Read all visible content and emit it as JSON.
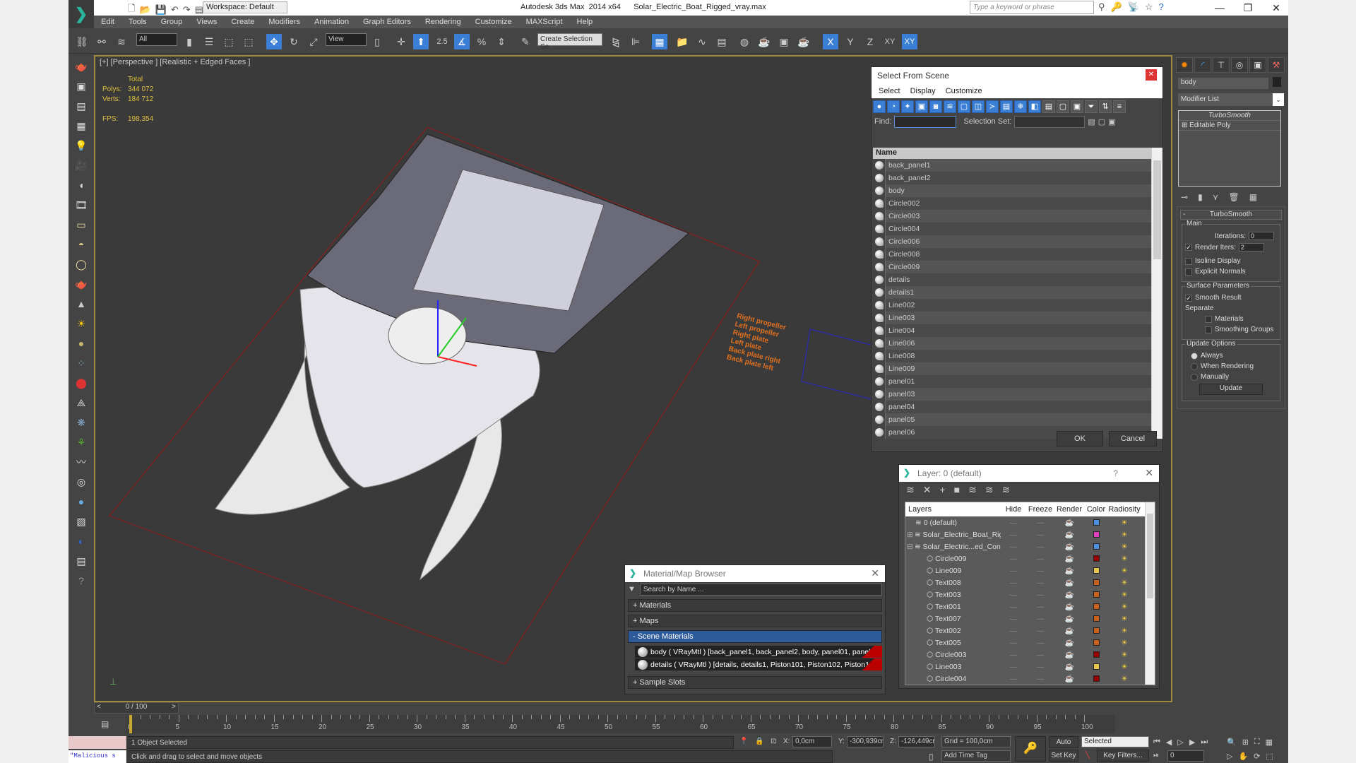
{
  "titlebar": {
    "workspace": "Workspace: Default",
    "app_title": "Autodesk 3ds Max  2014 x64",
    "file_name": "Solar_Electric_Boat_Rigged_vray.max",
    "search_placeholder": "Type a keyword or phrase"
  },
  "menu": [
    "Edit",
    "Tools",
    "Group",
    "Views",
    "Create",
    "Modifiers",
    "Animation",
    "Graph Editors",
    "Rendering",
    "Customize",
    "MAXScript",
    "Help"
  ],
  "toolbar": {
    "selection_filter": "All",
    "ref_coord": "View",
    "snap_angle": "2.5",
    "named_selection_placeholder": "Create Selection Se",
    "axes": [
      "X",
      "Y",
      "Z",
      "XY",
      "XY"
    ]
  },
  "viewport": {
    "label": "[+] [Perspective ] [Realistic + Edged Faces ]",
    "stats_header": "Total",
    "polys_label": "Polys:",
    "polys": "344 072",
    "verts_label": "Verts:",
    "verts": "184 712",
    "fps_label": "FPS:",
    "fps": "198,354",
    "control_labels": [
      "Right propeller",
      "Left propeller",
      "Right plate",
      "Left plate",
      "Back plate right",
      "Back plate left"
    ]
  },
  "select_from_scene": {
    "title": "Select From Scene",
    "menu": [
      "Select",
      "Display",
      "Customize"
    ],
    "find_label": "Find:",
    "selection_set_label": "Selection Set:",
    "column_name": "Name",
    "items": [
      {
        "name": "back_panel1",
        "type": "geometry"
      },
      {
        "name": "back_panel2",
        "type": "geometry"
      },
      {
        "name": "body",
        "type": "geometry"
      },
      {
        "name": "Circle002",
        "type": "shape"
      },
      {
        "name": "Circle003",
        "type": "shape"
      },
      {
        "name": "Circle004",
        "type": "shape"
      },
      {
        "name": "Circle006",
        "type": "shape"
      },
      {
        "name": "Circle008",
        "type": "shape"
      },
      {
        "name": "Circle009",
        "type": "shape"
      },
      {
        "name": "details",
        "type": "geometry"
      },
      {
        "name": "details1",
        "type": "geometry"
      },
      {
        "name": "Line002",
        "type": "shape"
      },
      {
        "name": "Line003",
        "type": "shape"
      },
      {
        "name": "Line004",
        "type": "shape"
      },
      {
        "name": "Line006",
        "type": "shape"
      },
      {
        "name": "Line008",
        "type": "shape"
      },
      {
        "name": "Line009",
        "type": "shape"
      },
      {
        "name": "panel01",
        "type": "geometry"
      },
      {
        "name": "panel03",
        "type": "geometry"
      },
      {
        "name": "panel04",
        "type": "geometry"
      },
      {
        "name": "panel05",
        "type": "geometry"
      },
      {
        "name": "panel06",
        "type": "geometry"
      }
    ],
    "ok": "OK",
    "cancel": "Cancel"
  },
  "layer_dialog": {
    "title": "Layer: 0 (default)",
    "help": "?",
    "columns": [
      "Layers",
      "Hide",
      "Freeze",
      "Render",
      "Color",
      "Radiosity"
    ],
    "rows": [
      {
        "name": "0 (default)",
        "indent": 1,
        "color": "#4a90e2"
      },
      {
        "name": "Solar_Electric_Boat_Rig",
        "indent": 0,
        "expander": "+",
        "color": "#e040c0"
      },
      {
        "name": "Solar_Electric...ed_Con",
        "indent": 0,
        "expander": "-",
        "color": "#4a90e2"
      },
      {
        "name": "Circle009",
        "indent": 2,
        "color": "#9b0000"
      },
      {
        "name": "Line009",
        "indent": 2,
        "color": "#e8c84a"
      },
      {
        "name": "Text008",
        "indent": 2,
        "color": "#c8601a"
      },
      {
        "name": "Text003",
        "indent": 2,
        "color": "#c8601a"
      },
      {
        "name": "Text001",
        "indent": 2,
        "color": "#c8601a"
      },
      {
        "name": "Text007",
        "indent": 2,
        "color": "#c8601a"
      },
      {
        "name": "Text002",
        "indent": 2,
        "color": "#c8601a"
      },
      {
        "name": "Text005",
        "indent": 2,
        "color": "#c8601a"
      },
      {
        "name": "Circle003",
        "indent": 2,
        "color": "#9b0000"
      },
      {
        "name": "Line003",
        "indent": 2,
        "color": "#e8c84a"
      },
      {
        "name": "Circle004",
        "indent": 2,
        "color": "#9b0000"
      }
    ]
  },
  "material_browser": {
    "title": "Material/Map Browser",
    "search_placeholder": "Search by Name ...",
    "sections": [
      "+ Materials",
      "+ Maps",
      "- Scene Materials",
      "+ Sample Slots"
    ],
    "scene_materials": [
      "body  ( VRayMtl ) [back_panel1, back_panel2, body, panel01, panel...",
      "details  ( VRayMtl ) [details, details1, Piston101, Piston102, Piston1..."
    ]
  },
  "command_panel": {
    "object_name": "body",
    "modifier_list": "Modifier List",
    "stack": [
      "TurboSmooth",
      "Editable Poly"
    ],
    "rollout_title": "TurboSmooth",
    "main_group": "Main",
    "iterations_label": "Iterations:",
    "iterations": "0",
    "render_iters_label": "Render Iters:",
    "render_iters": "2",
    "render_iters_checked": true,
    "isoline_display": "Isoline Display",
    "explicit_normals": "Explicit Normals",
    "surface_group": "Surface Parameters",
    "smooth_result": "Smooth Result",
    "separate": "Separate",
    "materials": "Materials",
    "smoothing_groups": "Smoothing Groups",
    "update_group": "Update Options",
    "update_options": [
      "Always",
      "When Rendering",
      "Manually"
    ],
    "update_selected": "Always",
    "update_button": "Update"
  },
  "timeline": {
    "frame_slider": "0 / 100",
    "ticks": [
      "0",
      "5",
      "10",
      "15",
      "20",
      "25",
      "30",
      "35",
      "40",
      "45",
      "50",
      "55",
      "60",
      "65",
      "70",
      "75",
      "80",
      "85",
      "90",
      "95",
      "100"
    ]
  },
  "statusbar": {
    "maxscript_text": "\"Malicious s",
    "selection_status": "1 Object Selected",
    "prompt": "Click and drag to select and move objects",
    "x_label": "X:",
    "x": "0,0cm",
    "y_label": "Y:",
    "y": "-300,939cr",
    "z_label": "Z:",
    "z": "-126,449cr",
    "grid": "Grid = 100,0cm",
    "add_time_tag": "Add Time Tag",
    "auto_key": "Auto Key",
    "set_key": "Set Key",
    "key_mode": "Selected",
    "key_filters": "Key Filters...",
    "current_frame": "0"
  }
}
